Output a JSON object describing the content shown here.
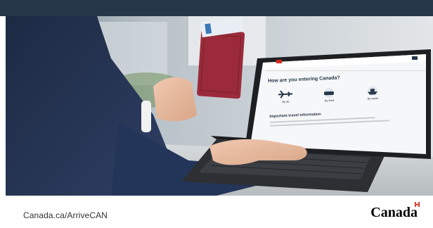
{
  "screen": {
    "question": "How are you entering Canada?",
    "section_heading": "Important travel information",
    "options": [
      {
        "label": "By air",
        "icon": "airplane-icon"
      },
      {
        "label": "By land",
        "icon": "car-icon"
      },
      {
        "label": "By water",
        "icon": "ship-icon"
      }
    ]
  },
  "footer": {
    "url": "Canada.ca/ArriveCAN",
    "wordmark": "Canada"
  },
  "colors": {
    "topbar": "#26374a",
    "passport": "#9b2b3a",
    "flag_red": "#d52b1e"
  }
}
